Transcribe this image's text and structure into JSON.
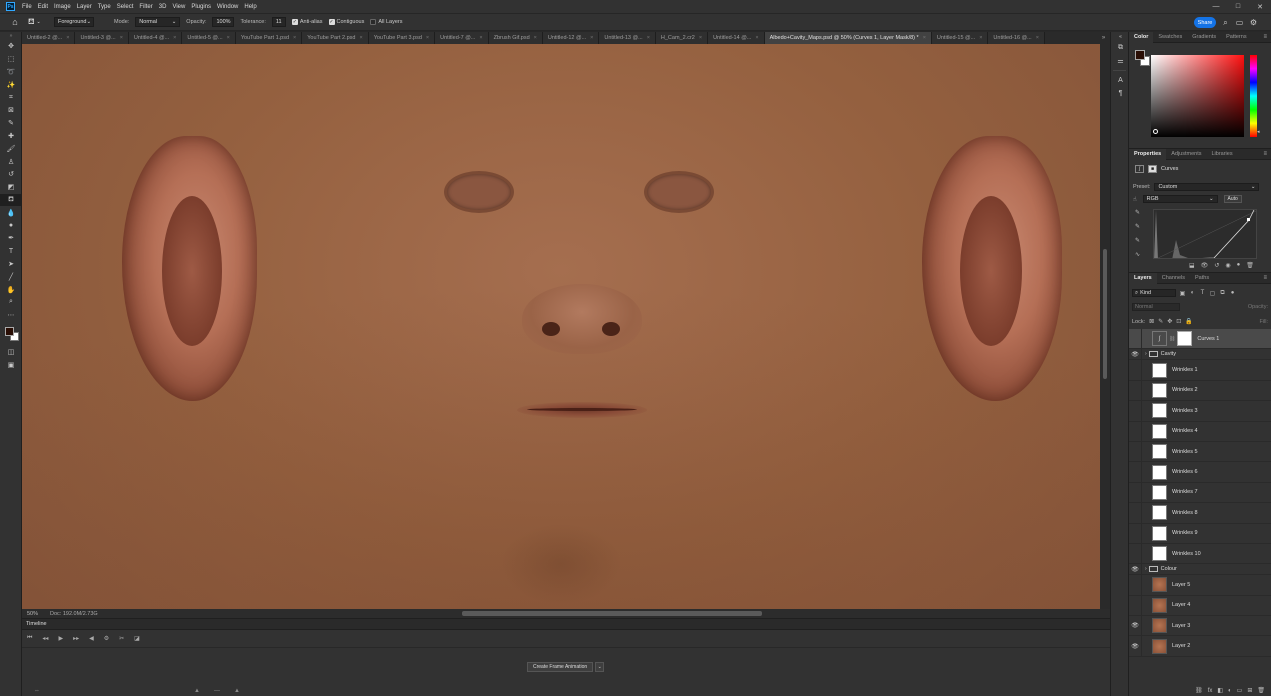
{
  "menubar": {
    "logo": "Ps",
    "items": [
      "File",
      "Edit",
      "Image",
      "Layer",
      "Type",
      "Select",
      "Filter",
      "3D",
      "View",
      "Plugins",
      "Window",
      "Help"
    ],
    "window_controls": [
      "—",
      "□",
      "✕"
    ]
  },
  "options": {
    "source_select": "Foreground",
    "mode_label": "Mode:",
    "mode_value": "Normal",
    "opacity_label": "Opacity:",
    "opacity_value": "100%",
    "tolerance_label": "Tolerance:",
    "tolerance_value": "11",
    "anti_alias": "Anti-alias",
    "contiguous": "Contiguous",
    "all_layers": "All Layers",
    "share": "Share"
  },
  "tabs": [
    {
      "label": "Untitled-2 @...",
      "active": false
    },
    {
      "label": "Untitled-3 @...",
      "active": false
    },
    {
      "label": "Untitled-4 @...",
      "active": false
    },
    {
      "label": "Untitled-5 @...",
      "active": false
    },
    {
      "label": "YouTube Part 1.psd",
      "active": false
    },
    {
      "label": "YouTube Part 2.psd",
      "active": false
    },
    {
      "label": "YouTube Part 3.psd",
      "active": false
    },
    {
      "label": "Untitled-7 @...",
      "active": false
    },
    {
      "label": "Zbrush Gif.psd",
      "active": false
    },
    {
      "label": "Untitled-12 @...",
      "active": false
    },
    {
      "label": "Untitled-13 @...",
      "active": false
    },
    {
      "label": "H_Cam_2.cr2",
      "active": false
    },
    {
      "label": "Untitled-14 @...",
      "active": false
    },
    {
      "label": "Albedo+Cavity_Maps.psd @ 50% (Curves 1, Layer Mask/8) *",
      "active": true
    },
    {
      "label": "Untitled-15 @...",
      "active": false
    },
    {
      "label": "Untitled-16 @...",
      "active": false
    }
  ],
  "status": {
    "zoom": "50%",
    "doc": "Doc: 192.0M/2.73G"
  },
  "timeline": {
    "title": "Timeline",
    "create_button": "Create Frame Animation"
  },
  "color_panel": {
    "tabs": [
      "Color",
      "Swatches",
      "Gradients",
      "Patterns"
    ],
    "fg": "#2a0e05",
    "bg": "#ffffff"
  },
  "properties_panel": {
    "tabs": [
      "Properties",
      "Adjustments",
      "Libraries"
    ],
    "title": "Curves",
    "preset_label": "Preset:",
    "preset_value": "Custom",
    "channel": "RGB",
    "auto": "Auto"
  },
  "layers_panel": {
    "tabs": [
      "Layers",
      "Channels",
      "Paths"
    ],
    "kind": "Kind",
    "blend": "Normal",
    "opacity_label": "Opacity:",
    "lock_label": "Lock:",
    "fill_label": "Fill:",
    "layers": [
      {
        "name": "Curves 1",
        "type": "adjustment",
        "visible": false,
        "selected": true
      },
      {
        "name": "Cavity",
        "type": "group",
        "visible": true
      },
      {
        "name": "Wrinkles 1",
        "type": "white",
        "visible": false
      },
      {
        "name": "Wrinkles 2",
        "type": "white",
        "visible": false
      },
      {
        "name": "Wrinkles 3",
        "type": "white",
        "visible": false
      },
      {
        "name": "Wrinkles 4",
        "type": "white",
        "visible": false
      },
      {
        "name": "Wrinkles 5",
        "type": "white",
        "visible": false
      },
      {
        "name": "Wrinkles 6",
        "type": "white",
        "visible": false
      },
      {
        "name": "Wrinkles 7",
        "type": "white",
        "visible": false
      },
      {
        "name": "Wrinkles 8",
        "type": "white",
        "visible": false
      },
      {
        "name": "Wrinkles 9",
        "type": "white",
        "visible": false
      },
      {
        "name": "Wrinkles 10",
        "type": "white",
        "visible": false
      },
      {
        "name": "Colour",
        "type": "group",
        "visible": true
      },
      {
        "name": "Layer 5",
        "type": "skin",
        "visible": false
      },
      {
        "name": "Layer 4",
        "type": "skin",
        "visible": false
      },
      {
        "name": "Layer 3",
        "type": "skin",
        "visible": true
      },
      {
        "name": "Layer 2",
        "type": "skin",
        "visible": true
      }
    ]
  }
}
